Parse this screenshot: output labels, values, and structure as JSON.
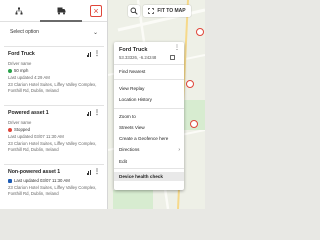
{
  "tabs": {
    "vehicles_icon": "sitemap-icon",
    "assets_icon": "truck-icon",
    "close_label": "×"
  },
  "select": {
    "placeholder": "Select option"
  },
  "map": {
    "fit_label": "FIT TO MAP"
  },
  "vehicles": [
    {
      "name": "Ford Truck",
      "role": "Driver name",
      "status": "50 mph",
      "status_color": "#2aa34a",
      "updated": "Last updated 4:29 AM",
      "address": "23 Clarion Hotel Suites, Liffey Valley Complex, Fonthill Rd, Dublin, Ireland"
    },
    {
      "name": "Powered asset 1",
      "role": "Driver name",
      "status": "Stopped",
      "status_color": "#e0463a",
      "updated": "Last updated 03/07 11:30 AM",
      "address": "23 Clarion Hotel Suites, Liffey Valley Complex, Fonthill Rd, Dublin, Ireland"
    },
    {
      "name": "Non-powered asset 1",
      "role": "",
      "status": "Last updated 03/07 11:30 AM",
      "status_color": "#1e5db5",
      "updated": "",
      "address": "23 Clarion Hotel Suites, Liffey Valley Complex, Fonthill Rd, Dublin, Ireland"
    }
  ],
  "menu": {
    "title": "Ford Truck",
    "coords": "53.33326, -6.24248",
    "items": [
      "Find Nearest",
      "View Replay",
      "Location History",
      "Zoom to",
      "Streets View",
      "Create a Geofence here",
      "Directions",
      "Edit",
      "Device health check"
    ],
    "active_item": "Device health check"
  }
}
